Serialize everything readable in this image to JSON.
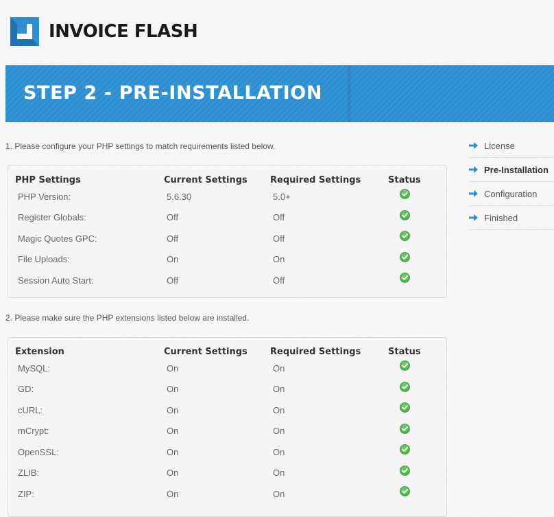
{
  "app": {
    "logo_text": "INVOICE FLASH"
  },
  "banner": {
    "title": "STEP 2 - PRE-INSTALLATION"
  },
  "section1": {
    "instruction": "1. Please configure your PHP settings to match requirements listed below.",
    "headers": [
      "PHP Settings",
      "Current Settings",
      "Required Settings",
      "Status"
    ],
    "rows": [
      {
        "name": "PHP Version:",
        "current": "5.6.30",
        "required": "5.0+",
        "status": "ok"
      },
      {
        "name": "Register Globals:",
        "current": "Off",
        "required": "Off",
        "status": "ok"
      },
      {
        "name": "Magic Quotes GPC:",
        "current": "Off",
        "required": "Off",
        "status": "ok"
      },
      {
        "name": "File Uploads:",
        "current": "On",
        "required": "On",
        "status": "ok"
      },
      {
        "name": "Session Auto Start:",
        "current": "Off",
        "required": "Off",
        "status": "ok"
      }
    ]
  },
  "section2": {
    "instruction": "2. Please make sure the PHP extensions listed below are installed.",
    "headers": [
      "Extension",
      "Current Settings",
      "Required Settings",
      "Status"
    ],
    "rows": [
      {
        "name": "MySQL:",
        "current": "On",
        "required": "On",
        "status": "ok"
      },
      {
        "name": "GD:",
        "current": "On",
        "required": "On",
        "status": "ok"
      },
      {
        "name": "cURL:",
        "current": "On",
        "required": "On",
        "status": "ok"
      },
      {
        "name": "mCrypt:",
        "current": "On",
        "required": "On",
        "status": "ok"
      },
      {
        "name": "OpenSSL:",
        "current": "On",
        "required": "On",
        "status": "ok"
      },
      {
        "name": "ZLIB:",
        "current": "On",
        "required": "On",
        "status": "ok"
      },
      {
        "name": "ZIP:",
        "current": "On",
        "required": "On",
        "status": "ok"
      }
    ]
  },
  "sidebar": {
    "steps": [
      {
        "label": "License",
        "active": false
      },
      {
        "label": "Pre-Installation",
        "active": true
      },
      {
        "label": "Configuration",
        "active": false
      },
      {
        "label": "Finished",
        "active": false
      }
    ]
  },
  "colors": {
    "accent": "#2d8fd2",
    "check": "#4cb848"
  },
  "icons": {
    "status_ok": "check-circle-icon",
    "step_arrow": "arrow-right-icon",
    "logo": "logo-icon"
  }
}
